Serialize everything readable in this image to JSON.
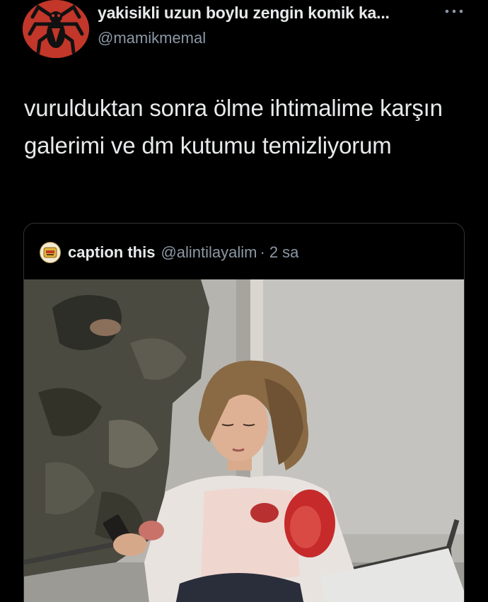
{
  "tweet": {
    "author": {
      "display_name": "yakisikli uzun boylu zengin komik ka...",
      "handle": "@mamikmemal",
      "avatar_icon": "spider-emblem-avatar"
    },
    "more_icon": "more-options-icon",
    "text": "vurulduktan sonra ölme ihtimalime karşın galerimi ve dm kutumu temizliyorum"
  },
  "quote": {
    "author": {
      "display_name": "caption this",
      "handle": "@alintilayalim",
      "separator": "·",
      "time": "2 sa",
      "avatar_icon": "caption-this-avatar"
    },
    "media": {
      "description_icon": "photo-injured-woman-with-phone"
    }
  },
  "colors": {
    "background": "#000000",
    "text_primary": "#e7e9ea",
    "text_secondary": "#8b98a5",
    "border": "#2f3336",
    "avatar_red": "#c2372a"
  }
}
